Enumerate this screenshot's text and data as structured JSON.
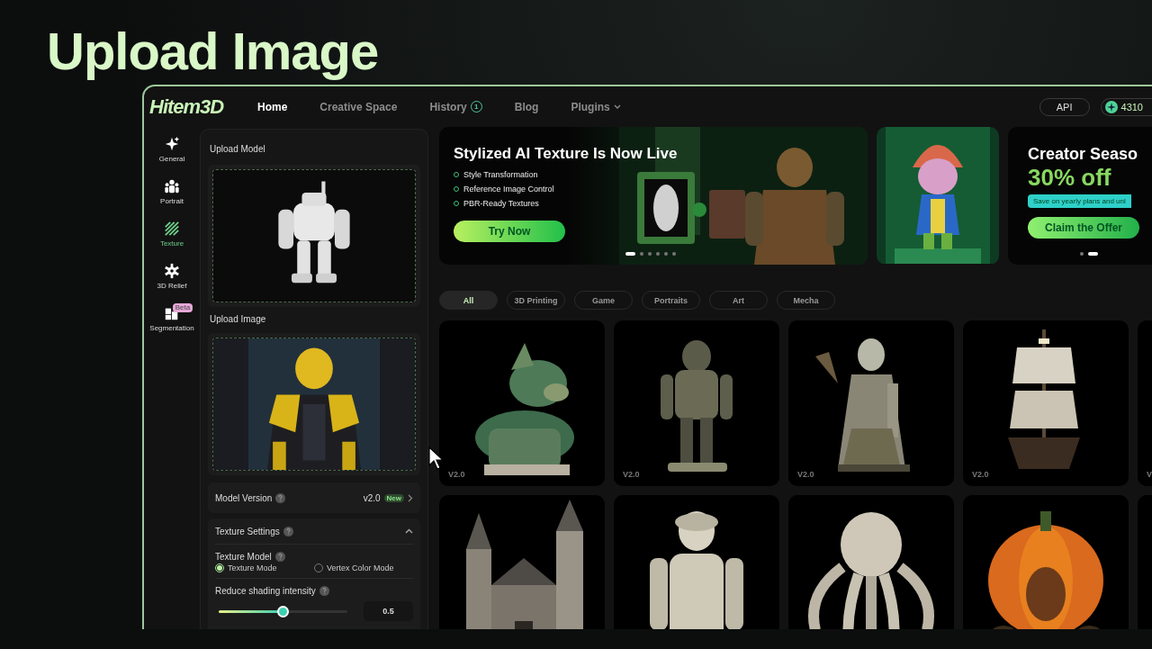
{
  "heading": "Upload Image",
  "nav": {
    "logo": "Hitem3D",
    "links": [
      {
        "label": "Home",
        "selected": true
      },
      {
        "label": "Creative Space",
        "selected": false
      },
      {
        "label": "History",
        "selected": false,
        "badge": "1"
      },
      {
        "label": "Blog",
        "selected": false
      },
      {
        "label": "Plugins",
        "selected": false,
        "dropdown": true
      }
    ],
    "api": "API",
    "credits": "4310"
  },
  "rail": [
    {
      "label": "General",
      "selected": false
    },
    {
      "label": "Portrait",
      "selected": false
    },
    {
      "label": "Texture",
      "selected": true
    },
    {
      "label": "3D Relief",
      "selected": false
    },
    {
      "label": "Segmentation",
      "selected": false,
      "badge": "Beta"
    }
  ],
  "panel": {
    "upload_model": {
      "label": "Upload Model",
      "kind": "picture"
    },
    "upload_image": {
      "label": "Upload Image",
      "kind": "picture"
    },
    "model_version": {
      "label": "Model Version",
      "value": "v2.0",
      "badge": "New"
    },
    "texture_settings": {
      "title": "Texture Settings",
      "expanded": true,
      "texture_model": {
        "label": "Texture Model",
        "options": [
          {
            "label": "Texture Mode",
            "selected": true
          },
          {
            "label": "Vertex Color Mode",
            "selected": false
          }
        ]
      },
      "shading": {
        "label": "Reduce shading intensity",
        "level": 0.5,
        "reading": "0.5"
      }
    }
  },
  "banners": [
    {
      "kind": "promo",
      "title": "Stylized AI Texture Is Now Live",
      "bullets": [
        "Style Transformation",
        "Reference Image Control",
        "PBR-Ready Textures"
      ],
      "button": "Try Now",
      "dots": [
        {
          "selected": true
        },
        {
          "selected": false
        },
        {
          "selected": false
        },
        {
          "selected": false
        },
        {
          "selected": false
        },
        {
          "selected": false
        }
      ]
    },
    {
      "kind": "picture"
    },
    {
      "kind": "offer",
      "title": "Creator Seaso",
      "big": "30% off",
      "note": "Save on yearly plans and unl",
      "button": "Claim the Offer",
      "dots": [
        {
          "selected": false
        },
        {
          "selected": true
        }
      ]
    }
  ],
  "filters": [
    {
      "label": "All",
      "selected": true
    },
    {
      "label": "3D Printing",
      "selected": false
    },
    {
      "label": "Game",
      "selected": false
    },
    {
      "label": "Portraits",
      "selected": false
    },
    {
      "label": "Art",
      "selected": false
    },
    {
      "label": "Mecha",
      "selected": false
    }
  ],
  "gallery": [
    {
      "kind": "picture",
      "tag": "V2.0"
    },
    {
      "kind": "picture",
      "tag": "V2.0"
    },
    {
      "kind": "picture",
      "tag": "V2.0"
    },
    {
      "kind": "picture",
      "tag": "V2.0"
    },
    {
      "kind": "picture",
      "tag": "V"
    },
    {
      "kind": "picture"
    },
    {
      "kind": "picture"
    },
    {
      "kind": "picture"
    },
    {
      "kind": "picture"
    },
    {
      "kind": "picture"
    }
  ]
}
